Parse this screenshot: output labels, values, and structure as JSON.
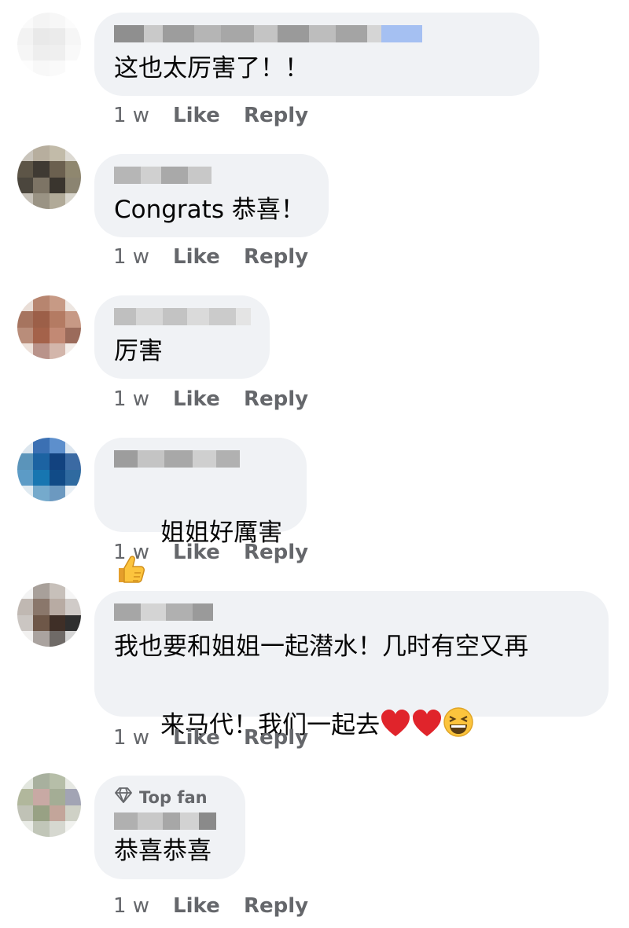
{
  "comments": [
    {
      "text": "这也太厉害了！！",
      "time": "1 w",
      "like": "Like",
      "reply": "Reply"
    },
    {
      "text": "Congrats 恭喜！",
      "time": "1 w",
      "like": "Like",
      "reply": "Reply"
    },
    {
      "text": "厉害",
      "time": "1 w",
      "like": "Like",
      "reply": "Reply"
    },
    {
      "text": "姐姐好厲害",
      "time": "1 w",
      "like": "Like",
      "reply": "Reply",
      "emoji": "thumbs-up"
    },
    {
      "text_line1": "我也要和姐姐一起潜水！几时有空又再",
      "text_line2": "来马代！我们一起去",
      "time": "1 w",
      "like": "Like",
      "reply": "Reply",
      "emoji": [
        "red-heart",
        "red-heart",
        "grinning-squinting-face"
      ]
    },
    {
      "badge": "Top fan",
      "badge_icon": "diamond-icon",
      "text": "恭喜恭喜",
      "time": "1 w",
      "like": "Like",
      "reply": "Reply"
    }
  ],
  "colors": {
    "bubble": "#f0f2f5",
    "meta": "#65676b",
    "text": "#050505"
  }
}
